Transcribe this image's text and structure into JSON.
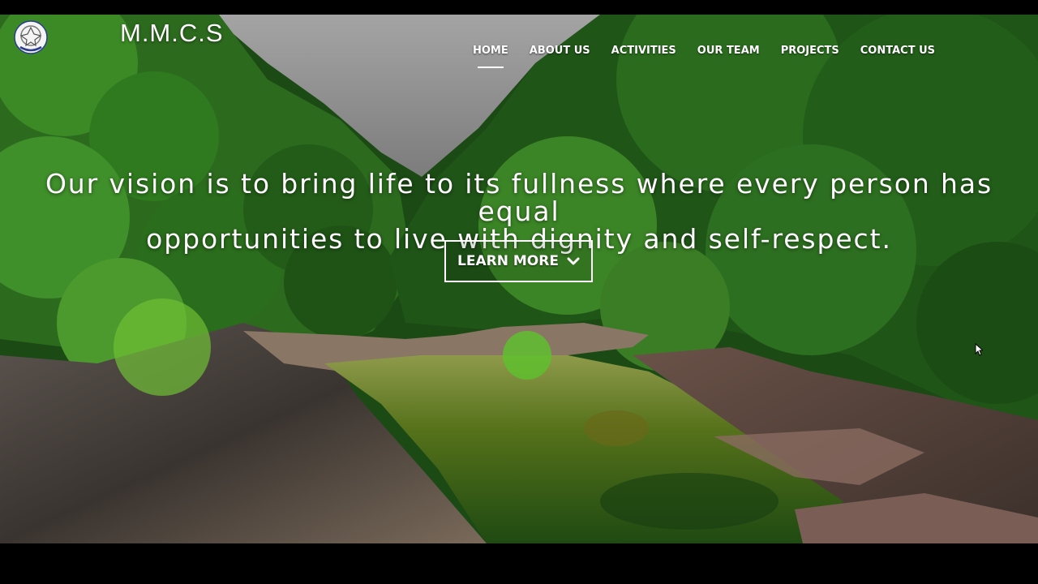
{
  "brand": {
    "name": "M.M.C.S",
    "logo_icon": "emblem-logo-icon"
  },
  "nav": {
    "items": [
      {
        "label": "HOME",
        "active": true
      },
      {
        "label": "ABOUT US"
      },
      {
        "label": "ACTIVITIES"
      },
      {
        "label": "OUR TEAM"
      },
      {
        "label": "PROJECTS"
      },
      {
        "label": "CONTACT US"
      }
    ]
  },
  "hero": {
    "line1": "Our vision is to bring life to its fullness where every person has equal",
    "line2": "opportunities to live with dignity and self-respect.",
    "cta_label": "LEARN MORE",
    "cta_icon": "chevron-down-icon"
  },
  "colors": {
    "forest": "#1f5a1a",
    "water": "#4d6b16",
    "sky": "#9d9d9d"
  }
}
